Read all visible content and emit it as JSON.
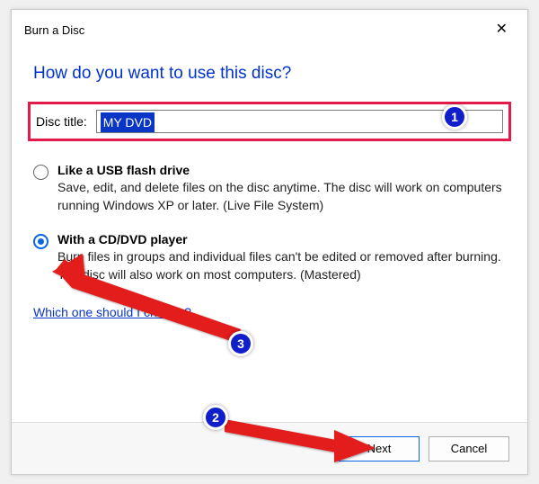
{
  "window": {
    "title": "Burn a Disc"
  },
  "heading": "How do you want to use this disc?",
  "disc_title": {
    "label": "Disc title:",
    "value": "MY DVD"
  },
  "options": {
    "usb": {
      "title": "Like a USB flash drive",
      "desc": "Save, edit, and delete files on the disc anytime. The disc will work on computers running Windows XP or later. (Live File System)",
      "selected": false
    },
    "player": {
      "title": "With a CD/DVD player",
      "desc": "Burn files in groups and individual files can't be edited or removed after burning. The disc will also work on most computers. (Mastered)",
      "selected": true
    }
  },
  "help_link": "Which one should I choose?",
  "buttons": {
    "next": "Next",
    "cancel": "Cancel"
  },
  "annotations": {
    "b1": "1",
    "b2": "2",
    "b3": "3"
  }
}
